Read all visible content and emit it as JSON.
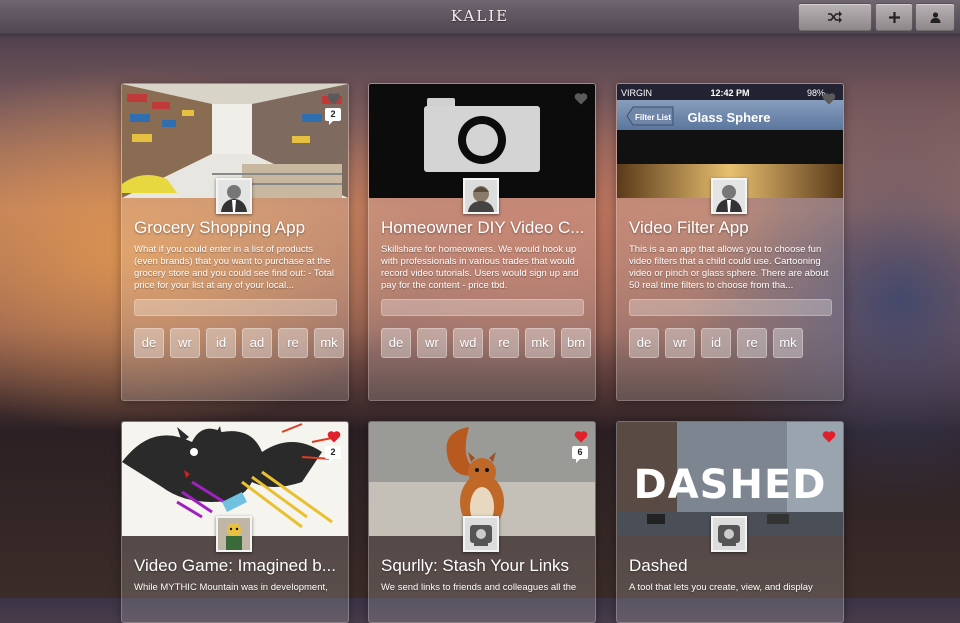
{
  "app": {
    "logo": "KALIE"
  },
  "toolbar": {
    "shuffle_icon": "shuffle-icon",
    "add_icon": "plus-icon",
    "user_icon": "user-icon"
  },
  "cards": [
    {
      "title": "Grocery Shopping App",
      "description": "What if you could enter in a list of products (even brands) that you want to purchase at the grocery store and you could see find out: - Total price for your list at any of your local...",
      "count": "2",
      "liked": false,
      "tags": [
        "de",
        "wr",
        "id",
        "ad",
        "re",
        "mk"
      ]
    },
    {
      "title": "Homeowner DIY Video C...",
      "description": "Skillshare for homeowners. We would hook up with professionals in various trades that would record video tutorials. Users would sign up and pay for the content - price tbd.",
      "liked": false,
      "tags": [
        "de",
        "wr",
        "wd",
        "re",
        "mk",
        "bm"
      ]
    },
    {
      "title": "Video Filter App",
      "description": "This is a an app that allows you to choose fun video filters that a child could use. Cartooning video or pinch or glass sphere. There are about 50 real time filters to choose from tha...",
      "liked": false,
      "thumb": {
        "carrier": "VIRGIN",
        "time": "12:42 PM",
        "battery": "98%",
        "back": "Filter List",
        "nav_title": "Glass Sphere"
      },
      "tags": [
        "de",
        "wr",
        "id",
        "re",
        "mk"
      ]
    },
    {
      "title": "Video Game: Imagined b...",
      "description": "While MYTHIC Mountain was in development,",
      "count": "2",
      "liked": true
    },
    {
      "title": "Squrlly: Stash Your Links",
      "description": "We send links to friends and colleagues all the",
      "count": "6",
      "liked": true
    },
    {
      "title": "Dashed",
      "description": "A tool that lets you create, view, and display",
      "liked": true,
      "thumb": {
        "sign": "DASHED"
      }
    }
  ],
  "colors": {
    "heart_liked": "#e0202a",
    "heart_unliked": "#5a5a5a"
  }
}
